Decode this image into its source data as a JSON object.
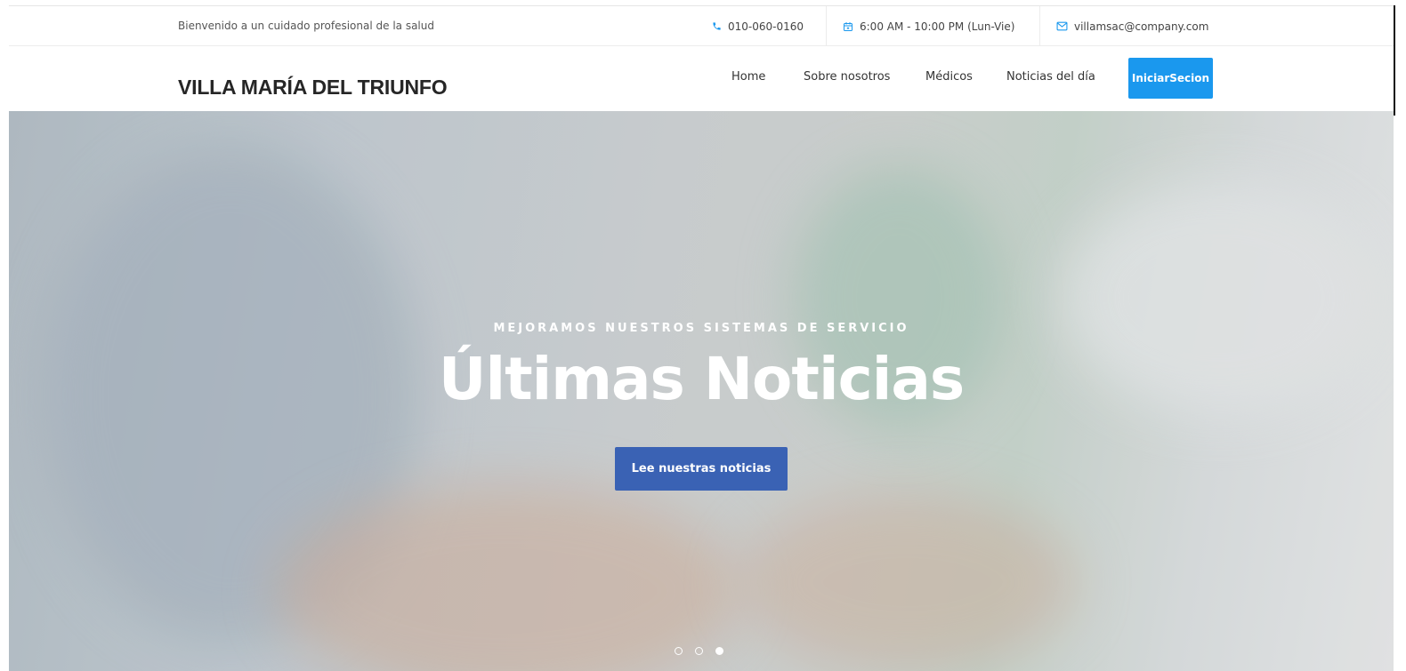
{
  "topbar": {
    "welcome": "Bienvenido a un cuidado profesional de la salud",
    "phone": "010-060-0160",
    "hours": "6:00 AM - 10:00 PM (Lun-Vie)",
    "email": "villamsac@company.com"
  },
  "header": {
    "brand": "VILLA MARÍA DEL TRIUNFO",
    "nav": [
      "Home",
      "Sobre nosotros",
      "Médicos",
      "Noticias del día"
    ],
    "login_label": "IniciarSecion"
  },
  "hero": {
    "subtitle": "MEJORAMOS NUESTROS SISTEMAS DE SERVICIO",
    "title": "Últimas Noticias",
    "button_label": "Lee nuestras noticias",
    "slides": 3,
    "active_slide": 3
  },
  "colors": {
    "accent_blue": "#1a98ee",
    "hero_button": "#3a62b4"
  }
}
